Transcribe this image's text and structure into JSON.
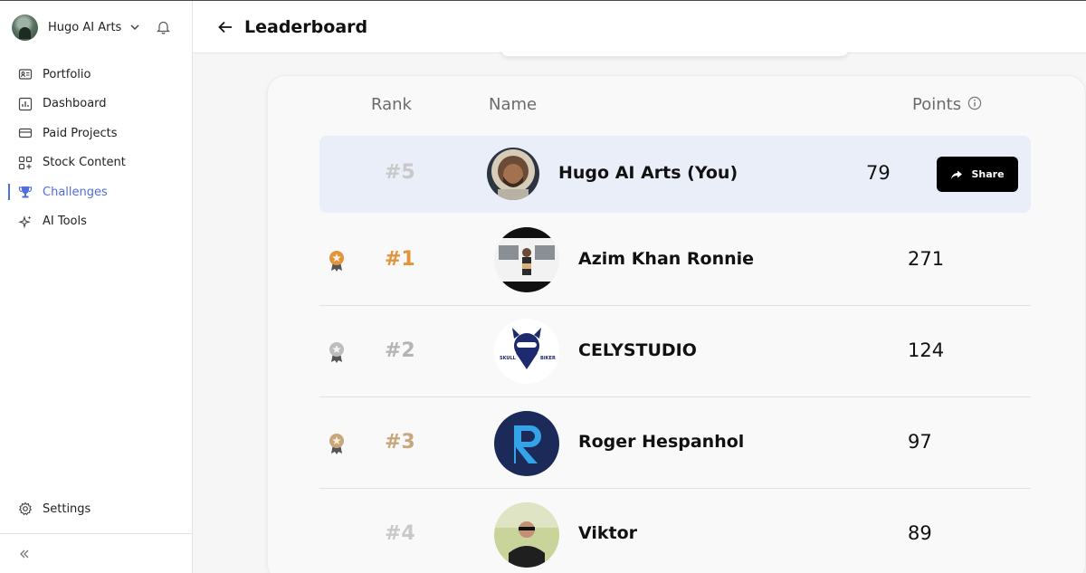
{
  "account": {
    "name": "Hugo AI Arts"
  },
  "nav": {
    "items": [
      {
        "label": "Portfolio",
        "icon": "portfolio-icon"
      },
      {
        "label": "Dashboard",
        "icon": "dashboard-icon"
      },
      {
        "label": "Paid Projects",
        "icon": "paid-projects-icon"
      },
      {
        "label": "Stock Content",
        "icon": "stock-content-icon"
      },
      {
        "label": "Challenges",
        "icon": "trophy-icon",
        "active": true
      },
      {
        "label": "AI Tools",
        "icon": "sparkle-icon"
      }
    ],
    "settings_label": "Settings",
    "accent": "#4f6fdc"
  },
  "header": {
    "title": "Leaderboard"
  },
  "table": {
    "columns": {
      "rank": "Rank",
      "name": "Name",
      "points": "Points"
    },
    "current_user": {
      "rank": "#5",
      "name": "Hugo AI Arts (You)",
      "points": "79",
      "share_label": "Share"
    },
    "rows": [
      {
        "rank": "#1",
        "name": "Azim Khan Ronnie",
        "points": "271",
        "medal": "gold"
      },
      {
        "rank": "#2",
        "name": "CELYSTUDIO",
        "points": "124",
        "medal": "silver"
      },
      {
        "rank": "#3",
        "name": "Roger Hespanhol",
        "points": "97",
        "medal": "bronze"
      },
      {
        "rank": "#4",
        "name": "Viktor",
        "points": "89",
        "medal": ""
      }
    ]
  },
  "logo_text": {
    "celystudio_left": "SKULL",
    "celystudio_right": "BIKER"
  }
}
